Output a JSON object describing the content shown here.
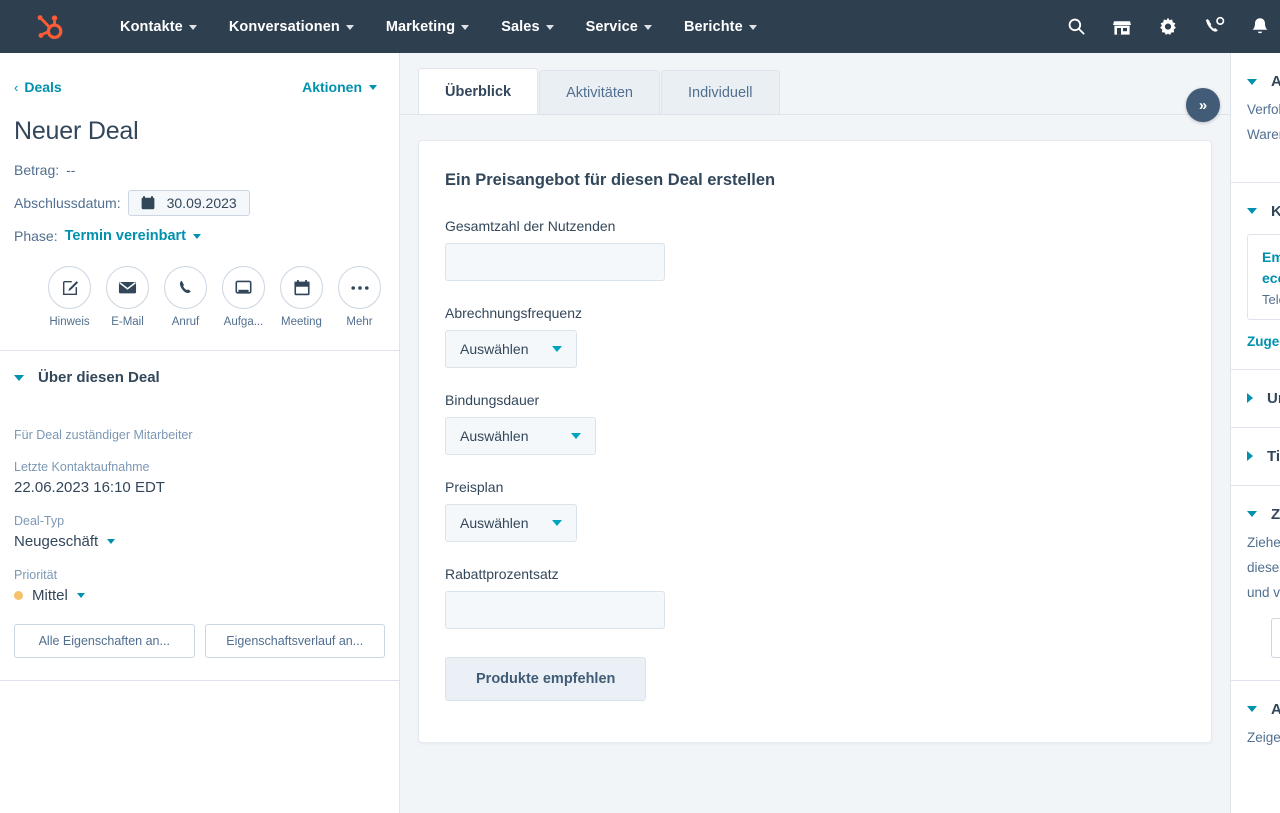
{
  "topnav": {
    "logo": "hubspot-sprocket-logo",
    "brand_color": "#ff5c35",
    "bg_color": "#2e3f50",
    "items": [
      {
        "label": "Kontakte"
      },
      {
        "label": "Konversationen"
      },
      {
        "label": "Marketing"
      },
      {
        "label": "Sales"
      },
      {
        "label": "Service"
      },
      {
        "label": "Berichte"
      }
    ],
    "icons": [
      {
        "name": "search-icon"
      },
      {
        "name": "marketplace-icon"
      },
      {
        "name": "settings-gear-icon"
      },
      {
        "name": "phone-call-icon"
      },
      {
        "name": "notifications-bell-icon"
      }
    ]
  },
  "left": {
    "breadcrumb": "Deals",
    "breadcrumb_chevron": "‹",
    "actions_label": "Aktionen",
    "title": "Neuer Deal",
    "amount_label": "Betrag:",
    "amount_value": "--",
    "close_date_label": "Abschlussdatum:",
    "close_date_value": "30.09.2023",
    "stage_label": "Phase:",
    "stage_value": "Termin vereinbart",
    "quick_actions": [
      {
        "label": "Hinweis",
        "icon": "note-pencil-icon"
      },
      {
        "label": "E-Mail",
        "icon": "envelope-icon"
      },
      {
        "label": "Anruf",
        "icon": "phone-icon"
      },
      {
        "label": "Aufga...",
        "icon": "task-icon"
      },
      {
        "label": "Meeting",
        "icon": "calendar-icon"
      },
      {
        "label": "Mehr",
        "icon": "ellipsis-icon"
      }
    ],
    "about_section_title": "Über diesen Deal",
    "owner_label": "Für Deal zuständiger Mitarbeiter",
    "last_contact_label": "Letzte Kontaktaufnahme",
    "last_contact_value": "22.06.2023 16:10 EDT",
    "deal_type_label": "Deal-Typ",
    "deal_type_value": "Neugeschäft",
    "priority_label": "Priorität",
    "priority_value": "Mittel",
    "priority_dot_color": "#f5c26b",
    "btn_all_properties": "Alle Eigenschaften an...",
    "btn_property_history": "Eigenschaftsverlauf an..."
  },
  "center": {
    "tabs": [
      {
        "label": "Überblick",
        "active": true
      },
      {
        "label": "Aktivitäten",
        "active": false
      },
      {
        "label": "Individuell",
        "active": false
      }
    ],
    "card_title": "Ein Preisangebot für diesen Deal erstellen",
    "fields": [
      {
        "label": "Gesamtzahl der Nutzenden",
        "type": "text",
        "value": ""
      },
      {
        "label": "Abrechnungsfrequenz",
        "type": "select",
        "value": "Auswählen"
      },
      {
        "label": "Bindungsdauer",
        "type": "select",
        "value": "Auswählen"
      },
      {
        "label": "Preisplan",
        "type": "select",
        "value": "Auswählen"
      },
      {
        "label": "Rabattprozentsatz",
        "type": "text",
        "value": ""
      }
    ],
    "submit_label": "Produkte empfehlen",
    "collapse_button": "»"
  },
  "right": {
    "sections": [
      {
        "title": "Art",
        "chevron": "down"
      },
      {
        "title": "Kon",
        "chevron": "down"
      },
      {
        "title": "Unt",
        "chevron": "right"
      },
      {
        "title": "Tic",
        "chevron": "right"
      },
      {
        "title": "Zah",
        "chevron": "down"
      },
      {
        "title": "Anh",
        "chevron": "down"
      }
    ],
    "artikel_line1": "Verfolg",
    "artikel_line2": "Waren",
    "contact_name": "Emili",
    "contact_email": "ecco",
    "contact_phone_label": "Telefo",
    "contact_assign_link": "Zugeor",
    "zahlungen_line1": "Ziehen",
    "zahlungen_line2": "diesem",
    "zahlungen_line3": "und ver",
    "anhaenge_line1": "Zeigen"
  }
}
